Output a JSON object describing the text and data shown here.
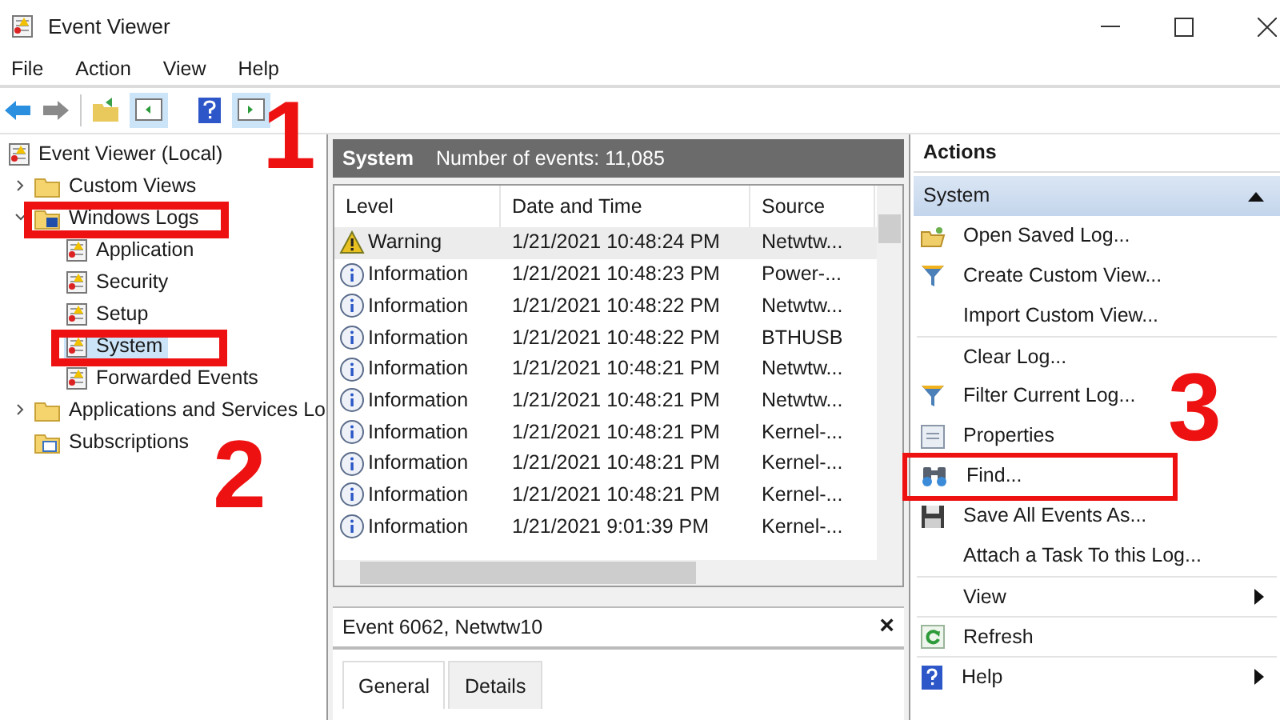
{
  "window": {
    "title": "Event Viewer"
  },
  "menu": [
    "File",
    "Action",
    "View",
    "Help"
  ],
  "tree": [
    {
      "label": "Event Viewer (Local)",
      "kind": "root",
      "selected": false,
      "children": [
        {
          "label": "Custom Views",
          "kind": "folder",
          "expanded": false,
          "selected": false
        },
        {
          "label": "Windows Logs",
          "kind": "logs-folder",
          "expanded": true,
          "selected": false,
          "children": [
            {
              "label": "Application",
              "kind": "log",
              "selected": false
            },
            {
              "label": "Security",
              "kind": "log",
              "selected": false
            },
            {
              "label": "Setup",
              "kind": "log",
              "selected": false
            },
            {
              "label": "System",
              "kind": "log",
              "selected": true
            },
            {
              "label": "Forwarded Events",
              "kind": "log",
              "selected": false
            }
          ]
        },
        {
          "label": "Applications and Services Lo",
          "kind": "folder",
          "expanded": false,
          "selected": false
        },
        {
          "label": "Subscriptions",
          "kind": "subscriptions",
          "selected": false
        }
      ]
    }
  ],
  "log_header": {
    "name": "System",
    "count": "Number of events: 11,085"
  },
  "table": {
    "columns": [
      "Level",
      "Date and Time",
      "Source"
    ],
    "rows": [
      {
        "kind": "warning",
        "level": "Warning",
        "date": "1/21/2021 10:48:24 PM",
        "source": "Netwtw...",
        "selected": true
      },
      {
        "kind": "information",
        "level": "Information",
        "date": "1/21/2021 10:48:23 PM",
        "source": "Power-...",
        "selected": false
      },
      {
        "kind": "information",
        "level": "Information",
        "date": "1/21/2021 10:48:22 PM",
        "source": "Netwtw...",
        "selected": false
      },
      {
        "kind": "information",
        "level": "Information",
        "date": "1/21/2021 10:48:22 PM",
        "source": "BTHUSB",
        "selected": false
      },
      {
        "kind": "information",
        "level": "Information",
        "date": "1/21/2021 10:48:21 PM",
        "source": "Netwtw...",
        "selected": false
      },
      {
        "kind": "information",
        "level": "Information",
        "date": "1/21/2021 10:48:21 PM",
        "source": "Netwtw...",
        "selected": false
      },
      {
        "kind": "information",
        "level": "Information",
        "date": "1/21/2021 10:48:21 PM",
        "source": "Kernel-...",
        "selected": false
      },
      {
        "kind": "information",
        "level": "Information",
        "date": "1/21/2021 10:48:21 PM",
        "source": "Kernel-...",
        "selected": false
      },
      {
        "kind": "information",
        "level": "Information",
        "date": "1/21/2021 10:48:21 PM",
        "source": "Kernel-...",
        "selected": false
      },
      {
        "kind": "information",
        "level": "Information",
        "date": "1/21/2021 9:01:39 PM",
        "source": "Kernel-...",
        "selected": false
      }
    ]
  },
  "event_pane": {
    "title": "Event 6062, Netwtw10",
    "close": "×",
    "tabs": [
      {
        "label": "General",
        "selected": true
      },
      {
        "label": "Details",
        "selected": false
      }
    ]
  },
  "actions": {
    "title": "Actions",
    "section": "System",
    "items": [
      {
        "label": "Open Saved Log...",
        "kind": "folder",
        "separator_before": false,
        "submenu": false,
        "highlighted": false
      },
      {
        "label": "Create Custom View...",
        "kind": "filter",
        "separator_before": false,
        "submenu": false,
        "highlighted": false
      },
      {
        "label": "Import Custom View...",
        "kind": "none",
        "separator_before": false,
        "submenu": false,
        "highlighted": false
      },
      {
        "label": "Clear Log...",
        "kind": "none",
        "separator_before": true,
        "submenu": false,
        "highlighted": false
      },
      {
        "label": "Filter Current Log...",
        "kind": "filter",
        "separator_before": false,
        "submenu": false,
        "highlighted": false
      },
      {
        "label": "Properties",
        "kind": "properties",
        "separator_before": false,
        "submenu": false,
        "highlighted": false
      },
      {
        "label": "Find...",
        "kind": "binoculars",
        "separator_before": false,
        "submenu": false,
        "highlighted": true
      },
      {
        "label": "Save All Events As...",
        "kind": "disk",
        "separator_before": false,
        "submenu": false,
        "highlighted": false
      },
      {
        "label": "Attach a Task To this Log...",
        "kind": "none",
        "separator_before": false,
        "submenu": false,
        "highlighted": false
      },
      {
        "label": "View",
        "kind": "none",
        "separator_before": true,
        "submenu": true,
        "highlighted": false
      },
      {
        "label": "Refresh",
        "kind": "refresh",
        "separator_before": true,
        "submenu": false,
        "highlighted": false
      },
      {
        "label": "Help",
        "kind": "help",
        "separator_before": true,
        "submenu": true,
        "highlighted": false
      }
    ]
  },
  "annotations": [
    {
      "number": "1"
    },
    {
      "number": "2"
    },
    {
      "number": "3"
    }
  ]
}
